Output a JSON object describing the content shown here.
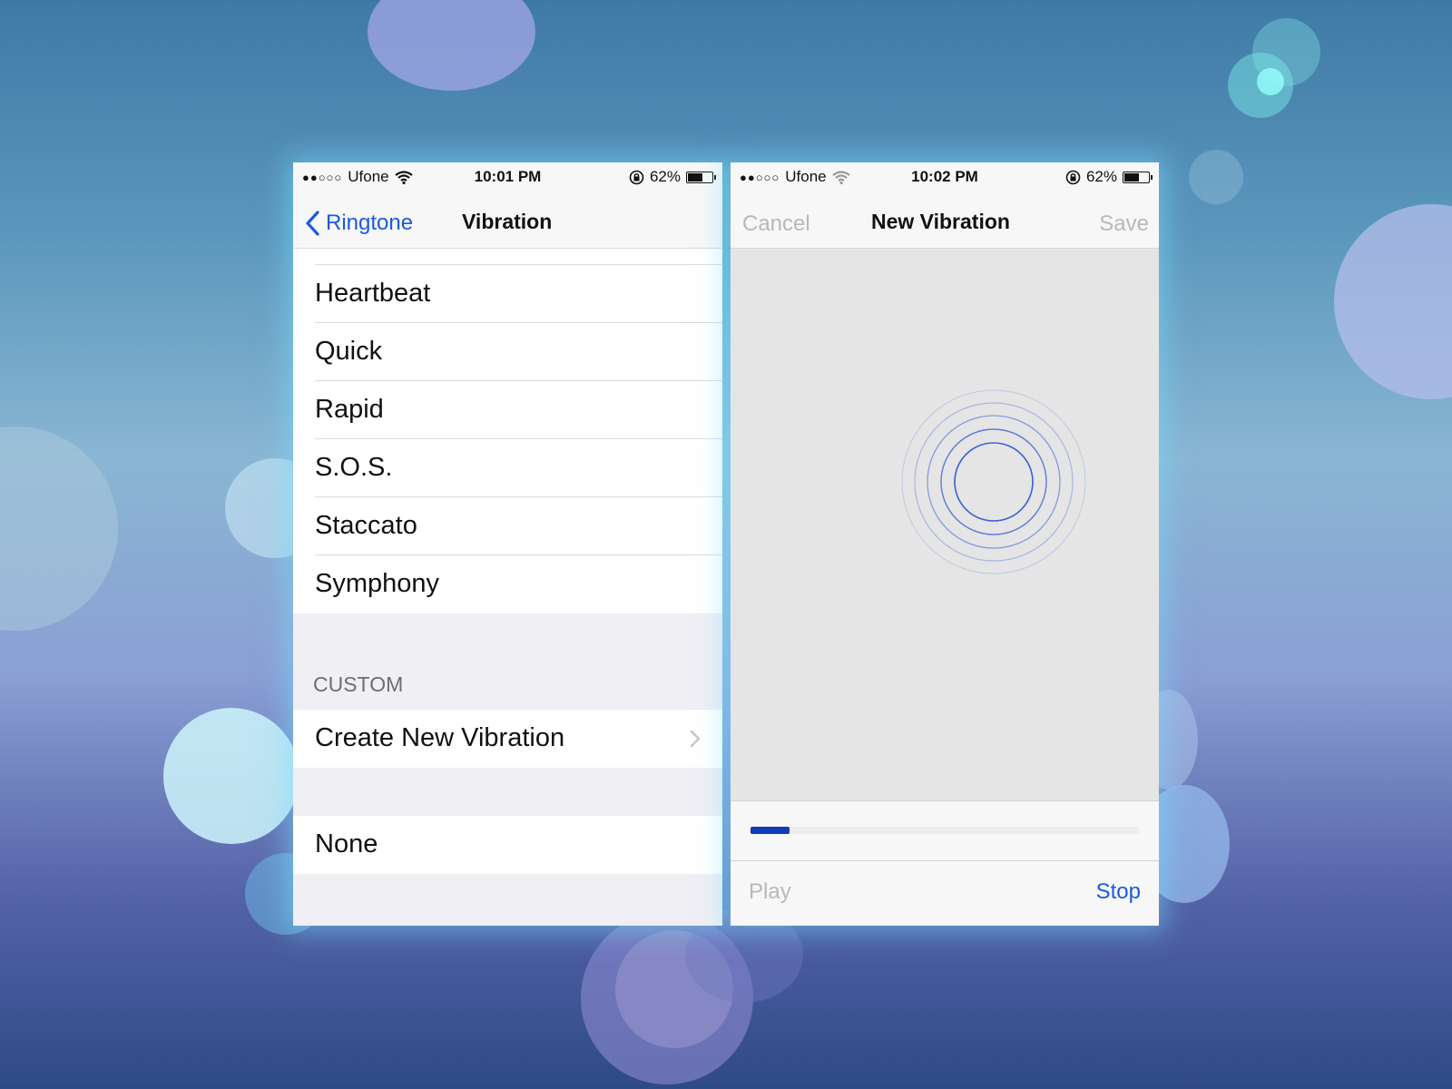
{
  "colors": {
    "accent": "#1a5bdb",
    "disabled": "#b8b8bc",
    "progress": "#0f3fb8",
    "ring": "#3a5fd6"
  },
  "left": {
    "status": {
      "signal": "●●○○○",
      "carrier": "Ufone",
      "time": "10:01 PM",
      "battery": "62%",
      "battery_level": 0.62
    },
    "nav": {
      "back_label": "Ringtone",
      "title": "Vibration"
    },
    "standard_items": [
      "Heartbeat",
      "Quick",
      "Rapid",
      "S.O.S.",
      "Staccato",
      "Symphony"
    ],
    "custom_header": "CUSTOM",
    "custom_item": "Create New Vibration",
    "none_item": "None"
  },
  "right": {
    "status": {
      "signal": "●●○○○",
      "carrier": "Ufone",
      "time": "10:02 PM",
      "battery": "62%",
      "battery_level": 0.62
    },
    "nav": {
      "cancel_label": "Cancel",
      "title": "New Vibration",
      "save_label": "Save"
    },
    "progress": 0.1,
    "toolbar": {
      "play_label": "Play",
      "stop_label": "Stop"
    }
  }
}
